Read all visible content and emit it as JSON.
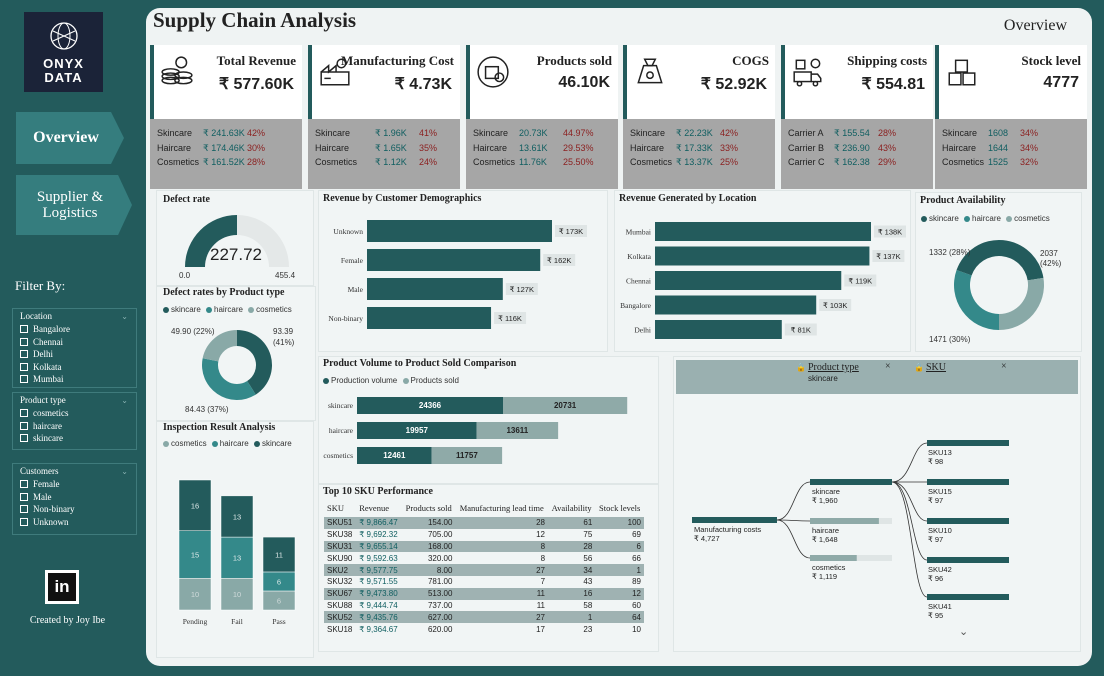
{
  "sidebar": {
    "logo_line1": "ONYX",
    "logo_line2": "DATA",
    "nav": [
      {
        "label": "Overview"
      },
      {
        "label": "Supplier & Logistics"
      }
    ],
    "filter_title": "Filter By:",
    "filters": [
      {
        "title": "Location",
        "options": [
          "Bangalore",
          "Chennai",
          "Delhi",
          "Kolkata",
          "Mumbai"
        ]
      },
      {
        "title": "Product type",
        "options": [
          "cosmetics",
          "haircare",
          "skincare"
        ]
      },
      {
        "title": "Customers",
        "options": [
          "Female",
          "Male",
          "Non-binary",
          "Unknown"
        ]
      }
    ],
    "created_by": "Created by Joy Ibe",
    "linkedin": "in"
  },
  "header": {
    "title": "Supply Chain Analysis",
    "page": "Overview"
  },
  "kpis": [
    {
      "title": "Total Revenue",
      "value": "₹ 577.60K",
      "icon": "money-stack-icon",
      "rows": [
        [
          "Skincare",
          "₹ 241.63K",
          "42%"
        ],
        [
          "Haircare",
          "₹ 174.46K",
          "30%"
        ],
        [
          "Cosmetics",
          "₹ 161.52K",
          "28%"
        ]
      ]
    },
    {
      "title": "Manufacturing Cost",
      "value": "₹ 4.73K",
      "icon": "factory-worker-icon",
      "rows": [
        [
          "Skincare",
          "₹ 1.96K",
          "41%"
        ],
        [
          "Haircare",
          "₹ 1.65K",
          "35%"
        ],
        [
          "Cosmetics",
          "₹ 1.12K",
          "24%"
        ]
      ]
    },
    {
      "title": "Products sold",
      "value": "46.10K",
      "icon": "product-box-icon",
      "rows": [
        [
          "Skincare",
          "20.73K",
          "44.97%"
        ],
        [
          "Haircare",
          "13.61K",
          "29.53%"
        ],
        [
          "Cosmetics",
          "11.76K",
          "25.50%"
        ]
      ]
    },
    {
      "title": "COGS",
      "value": "₹ 52.92K",
      "icon": "money-bag-icon",
      "rows": [
        [
          "Skincare",
          "₹ 22.23K",
          "42%"
        ],
        [
          "Haircare",
          "₹ 17.33K",
          "33%"
        ],
        [
          "Cosmetics",
          "₹ 13.37K",
          "25%"
        ]
      ]
    },
    {
      "title": "Shipping costs",
      "value": "₹ 554.81",
      "icon": "delivery-truck-icon",
      "rows": [
        [
          "Carrier A",
          "₹ 155.54",
          "28%"
        ],
        [
          "Carrier B",
          "₹ 236.90",
          "43%"
        ],
        [
          "Carrier C",
          "₹ 162.38",
          "29%"
        ]
      ]
    },
    {
      "title": "Stock level",
      "value": "4777",
      "icon": "stacked-boxes-icon",
      "rows": [
        [
          "Skincare",
          "1608",
          "34%"
        ],
        [
          "Haircare",
          "1644",
          "34%"
        ],
        [
          "Cosmetics",
          "1525",
          "32%"
        ]
      ]
    }
  ],
  "defect_rate": {
    "title": "Defect rate",
    "value": "227.72",
    "min": "0.0",
    "max": "455.4",
    "fraction": 0.5
  },
  "defect_by_type": {
    "title": "Defect rates by Product type",
    "legend": [
      "skincare",
      "haircare",
      "cosmetics"
    ],
    "labels": [
      {
        "t": "49.90 (22%)"
      },
      {
        "t": "93.39"
      },
      {
        "t": "(41%)"
      },
      {
        "t": "84.43 (37%)"
      }
    ]
  },
  "inspection": {
    "title": "Inspection Result Analysis",
    "legend": [
      "cosmetics",
      "haircare",
      "skincare"
    ]
  },
  "revenue_demo": {
    "title": "Revenue by Customer Demographics"
  },
  "revenue_loc": {
    "title": "Revenue Generated by Location"
  },
  "availability": {
    "title": "Product Availability",
    "legend": [
      "skincare",
      "haircare",
      "cosmetics"
    ],
    "labels": [
      "1332 (28%)",
      "2037",
      "(42%)",
      "1471 (30%)"
    ]
  },
  "volume": {
    "title": "Product Volume to Product Sold Comparison",
    "legend": [
      "Production volume",
      "Products sold"
    ]
  },
  "sku_table": {
    "title": "Top 10 SKU Performance",
    "headers": [
      "SKU",
      "Revenue",
      "Products sold",
      "Manufacturing lead time",
      "Availability",
      "Stock levels"
    ],
    "rows": [
      [
        "SKU51",
        "₹ 9,866.47",
        "154.00",
        "28",
        "61",
        "100"
      ],
      [
        "SKU38",
        "₹ 9,692.32",
        "705.00",
        "12",
        "75",
        "69"
      ],
      [
        "SKU31",
        "₹ 9,655.14",
        "168.00",
        "8",
        "28",
        "6"
      ],
      [
        "SKU90",
        "₹ 9,592.63",
        "320.00",
        "8",
        "56",
        "66"
      ],
      [
        "SKU2",
        "₹ 9,577.75",
        "8.00",
        "27",
        "34",
        "1"
      ],
      [
        "SKU32",
        "₹ 9,571.55",
        "781.00",
        "7",
        "43",
        "89"
      ],
      [
        "SKU67",
        "₹ 9,473.80",
        "513.00",
        "11",
        "16",
        "12"
      ],
      [
        "SKU88",
        "₹ 9,444.74",
        "737.00",
        "11",
        "58",
        "60"
      ],
      [
        "SKU52",
        "₹ 9,435.76",
        "627.00",
        "27",
        "1",
        "64"
      ],
      [
        "SKU18",
        "₹ 9,364.67",
        "620.00",
        "17",
        "23",
        "10"
      ]
    ]
  },
  "decomp": {
    "filter1_label": "Product type",
    "filter1_value": "skincare",
    "filter2_label": "SKU",
    "root_label": "Manufacturing costs",
    "root_value": "₹ 4,727",
    "level1": [
      {
        "label": "skincare",
        "value": "₹ 1,960",
        "frac": 1
      },
      {
        "label": "haircare",
        "value": "₹ 1,648",
        "frac": 0.84
      },
      {
        "label": "cosmetics",
        "value": "₹ 1,119",
        "frac": 0.57
      }
    ],
    "level2": [
      {
        "label": "SKU13",
        "value": "₹ 98"
      },
      {
        "label": "SKU15",
        "value": "₹ 97"
      },
      {
        "label": "SKU10",
        "value": "₹ 97"
      },
      {
        "label": "SKU42",
        "value": "₹ 96"
      },
      {
        "label": "SKU41",
        "value": "₹ 95"
      }
    ]
  },
  "chart_data": [
    {
      "type": "bar",
      "title": "Revenue by Customer Demographics",
      "categories": [
        "Unknown",
        "Female",
        "Male",
        "Non-binary"
      ],
      "values": [
        173,
        162,
        127,
        116
      ],
      "labels": [
        "₹ 173K",
        "₹ 162K",
        "₹ 127K",
        "₹ 116K"
      ],
      "color": "#235b5c"
    },
    {
      "type": "bar",
      "title": "Revenue Generated by Location",
      "categories": [
        "Mumbai",
        "Kolkata",
        "Chennai",
        "Bangalore",
        "Delhi"
      ],
      "values": [
        138,
        137,
        119,
        103,
        81
      ],
      "labels": [
        "₹ 138K",
        "₹ 137K",
        "₹ 119K",
        "₹ 103K",
        "₹ 81K"
      ],
      "color": "#235b5c"
    },
    {
      "type": "bar",
      "title": "Product Volume to Product Sold Comparison",
      "categories": [
        "skincare",
        "haircare",
        "cosmetics"
      ],
      "series": [
        {
          "name": "Production volume",
          "values": [
            24366,
            19957,
            12461
          ]
        },
        {
          "name": "Products sold",
          "values": [
            20731,
            13611,
            11757
          ]
        }
      ]
    },
    {
      "type": "bar",
      "title": "Inspection Result Analysis",
      "categories": [
        "Pending",
        "Fail",
        "Pass"
      ],
      "series": [
        {
          "name": "cosmetics",
          "values": [
            10,
            10,
            6
          ]
        },
        {
          "name": "haircare",
          "values": [
            15,
            13,
            6
          ]
        },
        {
          "name": "skincare",
          "values": [
            16,
            13,
            11
          ]
        }
      ]
    },
    {
      "type": "pie",
      "title": "Product Availability",
      "categories": [
        "haircare",
        "skincare",
        "cosmetics"
      ],
      "values": [
        1471,
        2037,
        1332
      ]
    },
    {
      "type": "pie",
      "title": "Defect rates by Product type",
      "categories": [
        "skincare",
        "haircare",
        "cosmetics"
      ],
      "values": [
        93.39,
        84.43,
        49.9
      ]
    }
  ]
}
